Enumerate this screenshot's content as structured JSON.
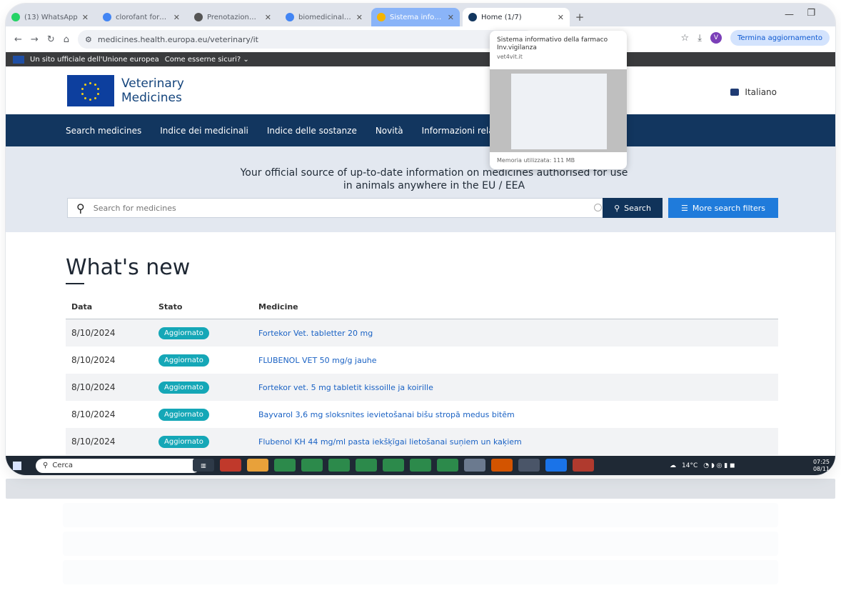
{
  "browser": {
    "tabs": [
      {
        "label": "(13) WhatsApp",
        "color": "#25d366"
      },
      {
        "label": "clorofant fornaci - Goo…",
        "color": "#4285f4"
      },
      {
        "label": "Prenotazione standard +",
        "color": "#555555"
      },
      {
        "label": "biomedicinalino expert…",
        "color": "#4285f4"
      },
      {
        "label": "Sistema informativo della…",
        "color": "#f4b400",
        "highlight": true
      },
      {
        "label": "Home (1/7)",
        "color": "#12365f",
        "active": true
      }
    ],
    "url": "medicines.health.europa.eu/veterinary/it",
    "update_label": "Termina aggiornamento",
    "profile_initial": "V"
  },
  "tab_preview": {
    "title": "Sistema informativo della farmaco",
    "subtitle": "Inv.vigilanza",
    "domain": "vet4vit.it",
    "memory": "Memoria utilizzata: 111 MB"
  },
  "eu_bar": {
    "text": "Un sito ufficiale dell'Unione europea",
    "link": "Come esserne sicuri? ⌄"
  },
  "site": {
    "logo_line1": "Veterinary",
    "logo_line2": "Medicines",
    "language": "Italiano",
    "nav": [
      "Search medicines",
      "Indice dei medicinali",
      "Indice delle sostanze",
      "Novità",
      "Informazioni relative a questo sito web"
    ]
  },
  "hero": {
    "tagline_1": "Your official source of up-to-date information on medicines authorised for use",
    "tagline_2": "in animals anywhere in the EU / EEA",
    "search_placeholder": "Search for medicines",
    "search_button": "Search",
    "filters_button": "More search filters"
  },
  "whats_new": {
    "heading": "What's new",
    "columns": [
      "Data",
      "Stato",
      "Medicine"
    ],
    "rows": [
      {
        "date": "8/10/2024",
        "status": "Aggiornato",
        "medicine": "Fortekor Vet. tabletter 20 mg"
      },
      {
        "date": "8/10/2024",
        "status": "Aggiornato",
        "medicine": "FLUBENOL VET 50 mg/g jauhe"
      },
      {
        "date": "8/10/2024",
        "status": "Aggiornato",
        "medicine": "Fortekor vet. 5 mg tabletit kissoille ja koirille"
      },
      {
        "date": "8/10/2024",
        "status": "Aggiornato",
        "medicine": "Bayvarol 3,6 mg sloksnites ievietošanai bišu stropā medus bitēm"
      },
      {
        "date": "8/10/2024",
        "status": "Aggiornato",
        "medicine": "Flubenol KH 44 mg/ml pasta iekšķīgai lietošanai suņiem un kaķiem"
      }
    ]
  },
  "taskbar": {
    "search_label": "Cerca",
    "weather": "14°C",
    "time": "07:25",
    "date": "08/11"
  }
}
